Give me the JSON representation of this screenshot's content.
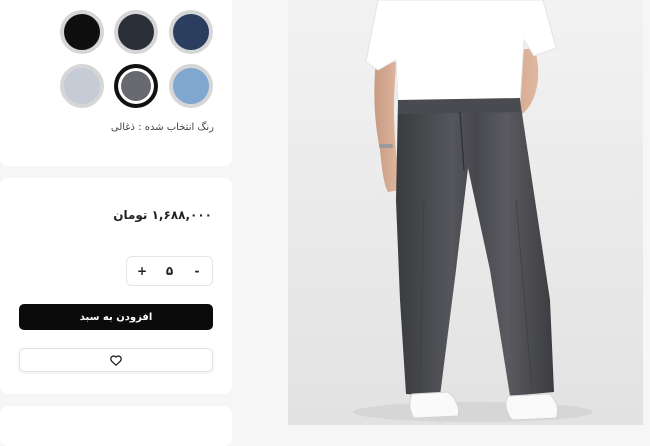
{
  "colors": {
    "swatches": [
      {
        "name": "black",
        "hex": "#0f0f10",
        "selected": false
      },
      {
        "name": "charcoal",
        "hex": "#2b2f38",
        "selected": false
      },
      {
        "name": "navy",
        "hex": "#2c3e5f",
        "selected": false
      },
      {
        "name": "light-gray",
        "hex": "#c5ccd6",
        "selected": false
      },
      {
        "name": "dark-gray",
        "hex": "#686870",
        "selected": true
      },
      {
        "name": "light-blue",
        "hex": "#7fa7cf",
        "selected": false
      }
    ],
    "selected_label": "رنگ انتخاب شده : ذغالی"
  },
  "purchase": {
    "price": "۱,۶۸۸,۰۰۰ تومان",
    "quantity": "۵",
    "plus_label": "+",
    "minus_label": "-",
    "add_to_cart_label": "افزودن به سبد"
  },
  "icons": {
    "wishlist": "heart-icon"
  },
  "product_image": {
    "subject": "model wearing white t-shirt, gray wide-leg jeans and white sneakers"
  }
}
